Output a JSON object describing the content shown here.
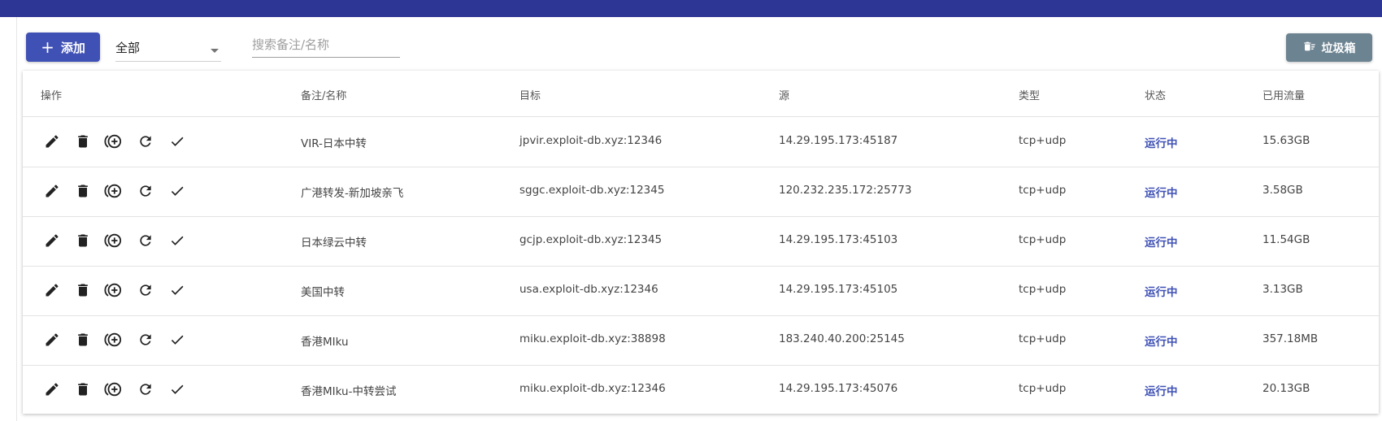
{
  "toolbar": {
    "add_label": "添加",
    "filter_value": "全部",
    "search_placeholder": "搜索备注/名称",
    "trash_label": "垃圾箱"
  },
  "table": {
    "headers": [
      "操作",
      "备注/名称",
      "目标",
      "源",
      "类型",
      "状态",
      "已用流量"
    ],
    "action_icons": [
      "edit-icon",
      "delete-icon",
      "add-circle-icon",
      "refresh-icon",
      "check-icon"
    ],
    "rows": [
      {
        "name": "VIR-日本中转",
        "target": "jpvir.exploit-db.xyz:12346",
        "source": "14.29.195.173:45187",
        "type": "tcp+udp",
        "status": "运行中",
        "traffic": "15.63GB"
      },
      {
        "name": "广港转发-新加坡亲飞",
        "target": "sggc.exploit-db.xyz:12345",
        "source": "120.232.235.172:25773",
        "type": "tcp+udp",
        "status": "运行中",
        "traffic": "3.58GB"
      },
      {
        "name": "日本绿云中转",
        "target": "gcjp.exploit-db.xyz:12345",
        "source": "14.29.195.173:45103",
        "type": "tcp+udp",
        "status": "运行中",
        "traffic": "11.54GB"
      },
      {
        "name": "美国中转",
        "target": "usa.exploit-db.xyz:12346",
        "source": "14.29.195.173:45105",
        "type": "tcp+udp",
        "status": "运行中",
        "traffic": "3.13GB"
      },
      {
        "name": "香港MIku",
        "target": "miku.exploit-db.xyz:38898",
        "source": "183.240.40.200:25145",
        "type": "tcp+udp",
        "status": "运行中",
        "traffic": "357.18MB"
      },
      {
        "name": "香港MIku-中转尝试",
        "target": "miku.exploit-db.xyz:12346",
        "source": "14.29.195.173:45076",
        "type": "tcp+udp",
        "status": "运行中",
        "traffic": "20.13GB"
      }
    ]
  },
  "colors": {
    "primary": "#3f51b5",
    "topbar": "#2d3595",
    "trash_button": "#6c8391",
    "status_running": "#3f51b5"
  }
}
